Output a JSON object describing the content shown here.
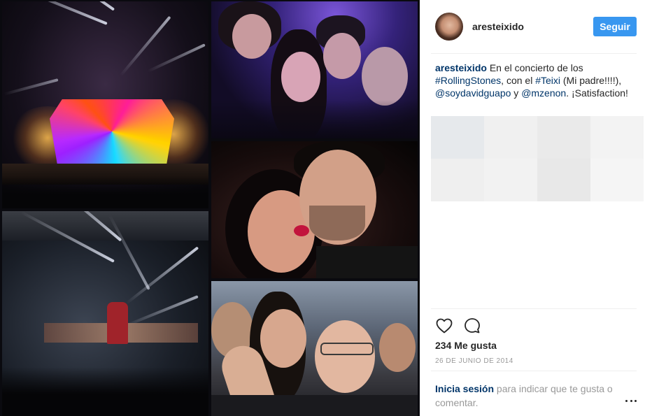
{
  "post": {
    "username": "aresteixido",
    "follow_label": "Seguir",
    "caption": {
      "username": "aresteixido",
      "text_1": " En el concierto de los ",
      "hashtag_1": "#RollingStones",
      "text_2": ", con el ",
      "hashtag_2": "#Teixi",
      "text_3": " (Mi padre!!!!), ",
      "mention_1": "@soydavidguapo",
      "text_4": " y ",
      "mention_2": "@mzenon",
      "text_5": ". ¡Satisfaction!"
    },
    "likes": "234 Me gusta",
    "date": "26 DE JUNIO DE 2014",
    "login_prompt": {
      "link": "Inicia sesión",
      "text": " para indicar que te gusta o comentar."
    }
  },
  "icons": {
    "like": "heart-icon",
    "comment": "comment-icon",
    "more": "more-options-icon"
  },
  "colors": {
    "follow_button": "#3897f0",
    "link": "#003569",
    "muted_text": "#999999",
    "text": "#262626",
    "placeholder_grid": [
      "#e6e9ec",
      "#f0f0f0",
      "#eaeaea",
      "#f3f3f3",
      "#efefef",
      "#f2f2f2",
      "#e8e8e8",
      "#f5f5f5"
    ]
  }
}
